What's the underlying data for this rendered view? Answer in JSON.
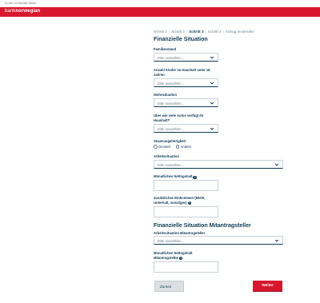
{
  "top_strip": {
    "text": "A part of Nordax Bank"
  },
  "brand": {
    "logo_light": "bank",
    "logo_bold": "norwegian",
    "color": "#d8172f"
  },
  "steps": [
    {
      "label": "Schritt 1",
      "active": false
    },
    {
      "label": "Schritt 2",
      "active": false
    },
    {
      "label": "Schritt 3",
      "active": true
    },
    {
      "label": "Schritt 4",
      "active": false
    },
    {
      "label": "Antrag einsenden",
      "active": false
    }
  ],
  "step_separator": "|",
  "section1": {
    "title": "Finanzielle Situation",
    "familienstand": {
      "label": "Familienstand",
      "value": "Bitte auswählen..."
    },
    "kinder": {
      "label": "Anzahl Kinder im Haushalt unter 18 Jahren",
      "value": "Bitte auswählen..."
    },
    "wohnsituation": {
      "label": "Wohnsituation",
      "value": "Bitte auswählen..."
    },
    "autos": {
      "label": "Über wie viele Autos verfügt Ihr Haushalt?",
      "value": "Bitte auswählen..."
    },
    "staatsangehoerigkeit": {
      "label": "Staatsangehörigkeit",
      "options": [
        "Deutsch",
        "Andere"
      ]
    },
    "arbeitssituation": {
      "label": "Arbeitssituation",
      "value": "Bitte auswählen..."
    },
    "nettogehalt": {
      "label": "Monatliches Nettogehalt",
      "value": ""
    },
    "einkommen": {
      "label": "Zusätzliches Einkommen (Miete, Unterhalt, sonstiges)",
      "value": ""
    }
  },
  "section2": {
    "title": "Finanzielle Situation Mitantragsteller",
    "arbeitssituation": {
      "label": "Arbeitssituation Mitantragsteller",
      "value": "Bitte auswählen..."
    },
    "nettogehalt": {
      "label": "Monatliches Nettogehalt Mitantragsteller",
      "value": ""
    }
  },
  "buttons": {
    "back": "Zurück",
    "next": "Weiter"
  },
  "icons": {
    "info": "info-icon",
    "chevron": "chevron-down-icon"
  }
}
